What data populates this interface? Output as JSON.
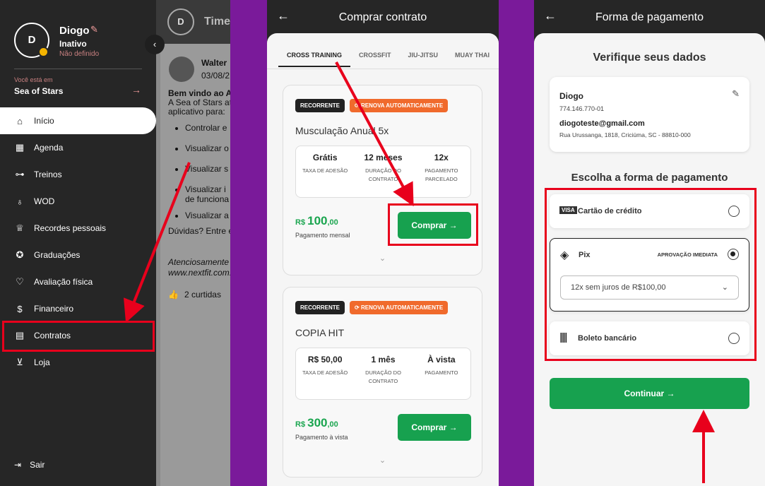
{
  "panel1": {
    "timeline": {
      "avatar_initial": "D",
      "title": "Timel",
      "author": "Walter",
      "date": "03/08/2",
      "greeting": "Bem vindo ao Api",
      "intro_1": "A Sea of Stars atr",
      "intro_2": "aplicativo para:",
      "bullets": [
        "Controlar e",
        "Visualizar o",
        "Visualizar s",
        "Visualizar i",
        "de funciona",
        "Visualizar a"
      ],
      "question": "Dúvidas? Entre em",
      "signoff": "Atenciosamente",
      "site": "www.nextfit.com.b",
      "likes": "2 curtidas"
    },
    "sidebar": {
      "avatar_initial": "D",
      "user_name": "Diogo",
      "status": "Inativo",
      "status_detail": "Não definido",
      "location_label": "Você está em",
      "location": "Sea of Stars",
      "items": [
        {
          "label": "Início",
          "icon": "home-icon",
          "glyph": "⌂"
        },
        {
          "label": "Agenda",
          "icon": "calendar-icon",
          "glyph": "▦"
        },
        {
          "label": "Treinos",
          "icon": "dumbbell-icon",
          "glyph": "⊶"
        },
        {
          "label": "WOD",
          "icon": "kettlebell-icon",
          "glyph": "♁"
        },
        {
          "label": "Recordes pessoais",
          "icon": "trophy-icon",
          "glyph": "♕"
        },
        {
          "label": "Graduações",
          "icon": "medal-icon",
          "glyph": "✪"
        },
        {
          "label": "Avaliação física",
          "icon": "heart-pulse-icon",
          "glyph": "♡"
        },
        {
          "label": "Financeiro",
          "icon": "dollar-icon",
          "glyph": "$"
        },
        {
          "label": "Contratos",
          "icon": "document-icon",
          "glyph": "▤"
        },
        {
          "label": "Loja",
          "icon": "cart-icon",
          "glyph": "⊻"
        }
      ],
      "logout": "Sair"
    }
  },
  "panel2": {
    "title": "Comprar contrato",
    "tabs": [
      "CROSS TRAINING",
      "CROSSFIT",
      "JIU-JITSU",
      "MUAY THAI"
    ],
    "cards": [
      {
        "badge_recurring": "RECORRENTE",
        "badge_auto": "RENOVA AUTOMATICAMENTE",
        "plan": "Musculação Anual 5x",
        "fee": "Grátis",
        "fee_label": "TAXA DE ADESÃO",
        "duration": "12 meses",
        "duration_label": "DURAÇÃO DO CONTRATO",
        "payment": "12x",
        "payment_label": "PAGAMENTO PARCELADO",
        "currency": "R$",
        "amount": "100",
        "cents": ",00",
        "price_sub": "Pagamento mensal",
        "buy": "Comprar →"
      },
      {
        "badge_recurring": "RECORRENTE",
        "badge_auto": "RENOVA AUTOMATICAMENTE",
        "plan": "COPIA HIT",
        "fee": "R$ 50,00",
        "fee_label": "TAXA DE ADESÃO",
        "duration": "1 mês",
        "duration_label": "DURAÇÃO DO CONTRATO",
        "payment": "À vista",
        "payment_label": "PAGAMENTO",
        "currency": "R$",
        "amount": "300",
        "cents": ",00",
        "price_sub": "Pagamento à vista",
        "buy": "Comprar →"
      }
    ]
  },
  "panel3": {
    "title": "Forma de pagamento",
    "verify": "Verifique seus dados",
    "name": "Diogo",
    "document": "774.146.770-01",
    "email": "diogoteste@gmail.com",
    "address": "Rua Urussanga, 1818, Criciúma, SC - 88810-000",
    "choose": "Escolha a forma de pagamento",
    "options": {
      "card": "Cartão de crédito",
      "pix": "Pix",
      "pix_badge": "APROVAÇÃO IMEDIATA",
      "installments": "12x sem juros de R$100,00",
      "boleto": "Boleto bancário"
    },
    "continue": "Continuar →",
    "colors": {
      "accent_green": "#17a14f",
      "annotation_red": "#e8001c",
      "badge_orange": "#f06a2c"
    }
  }
}
